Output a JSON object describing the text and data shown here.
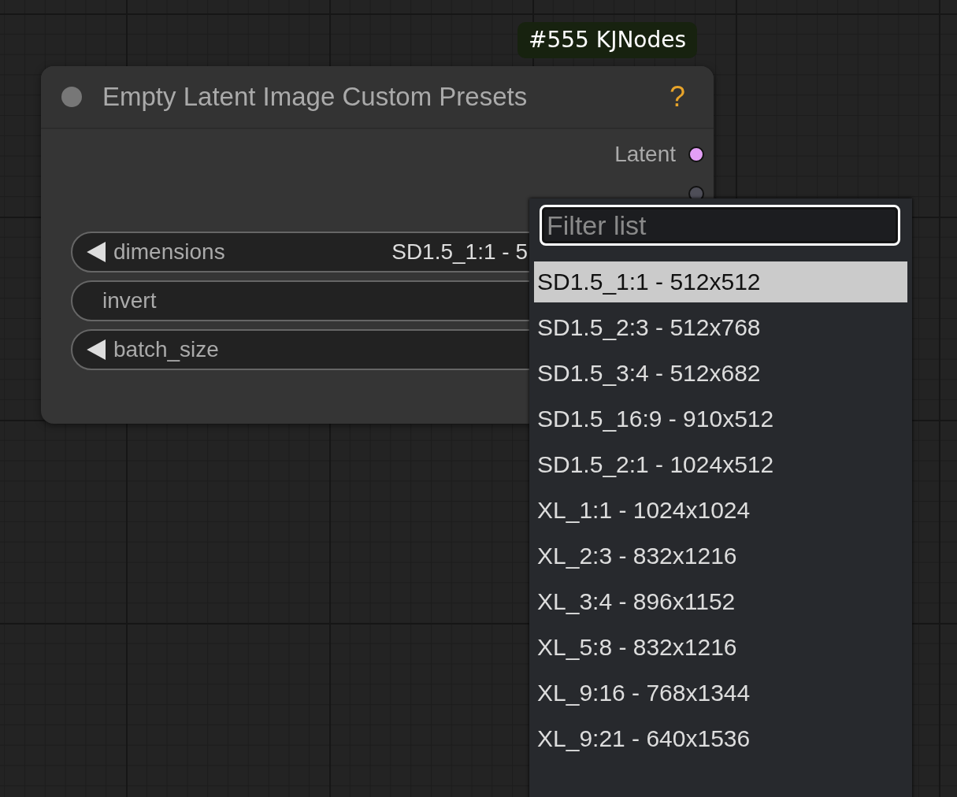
{
  "badge": "#555 KJNodes",
  "node": {
    "title": "Empty Latent Image Custom Presets",
    "help": "?",
    "outputs": [
      {
        "label": "Latent",
        "color": "#e39ff6"
      },
      {
        "color": "#4e4e58"
      }
    ],
    "widgets": [
      {
        "kind": "combo",
        "label": "dimensions",
        "value": "SD1.5_1:1 - 5"
      },
      {
        "kind": "toggle",
        "label": "invert"
      },
      {
        "kind": "number",
        "label": "batch_size"
      }
    ]
  },
  "dropdown": {
    "filter": {
      "placeholder": "Filter list"
    },
    "items": [
      {
        "label": "SD1.5_1:1 - 512x512",
        "selected": true
      },
      {
        "label": "SD1.5_2:3 - 512x768",
        "selected": false
      },
      {
        "label": "SD1.5_3:4 - 512x682",
        "selected": false
      },
      {
        "label": "SD1.5_16:9 - 910x512",
        "selected": false
      },
      {
        "label": "SD1.5_2:1 - 1024x512",
        "selected": false
      },
      {
        "label": "XL_1:1 - 1024x1024",
        "selected": false
      },
      {
        "label": "XL_2:3 - 832x1216",
        "selected": false
      },
      {
        "label": "XL_3:4 - 896x1152",
        "selected": false
      },
      {
        "label": "XL_5:8 - 832x1216",
        "selected": false
      },
      {
        "label": "XL_9:16 - 768x1344",
        "selected": false
      },
      {
        "label": "XL_9:21 - 640x1536",
        "selected": false
      }
    ]
  }
}
